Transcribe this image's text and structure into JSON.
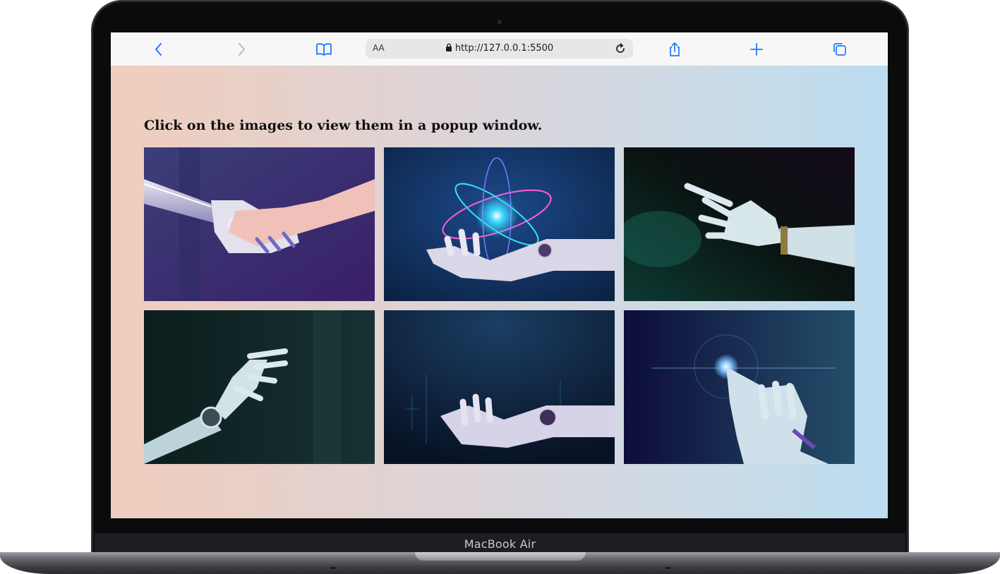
{
  "browser": {
    "url": "http://127.0.0.1:5500",
    "text_size_label": "AA",
    "icons": [
      "back-icon",
      "forward-icon",
      "bookmarks-icon",
      "lock-icon",
      "reload-icon",
      "share-icon",
      "new-tab-icon",
      "tabs-icon"
    ]
  },
  "page": {
    "heading": "Click on the images to view them in a popup window.",
    "gallery": [
      {
        "subject": "robot hand shaking human hand"
      },
      {
        "subject": "robot hand holding glowing atom"
      },
      {
        "subject": "robot hand pointing"
      },
      {
        "subject": "robot hand reaching"
      },
      {
        "subject": "robot hand open palm"
      },
      {
        "subject": "robot finger touching light"
      }
    ]
  },
  "device": {
    "label": "MacBook Air"
  },
  "colors": {
    "accent": "#1f7aff",
    "gradient_left": "#f1cdbd",
    "gradient_right": "#bbdcf0"
  }
}
